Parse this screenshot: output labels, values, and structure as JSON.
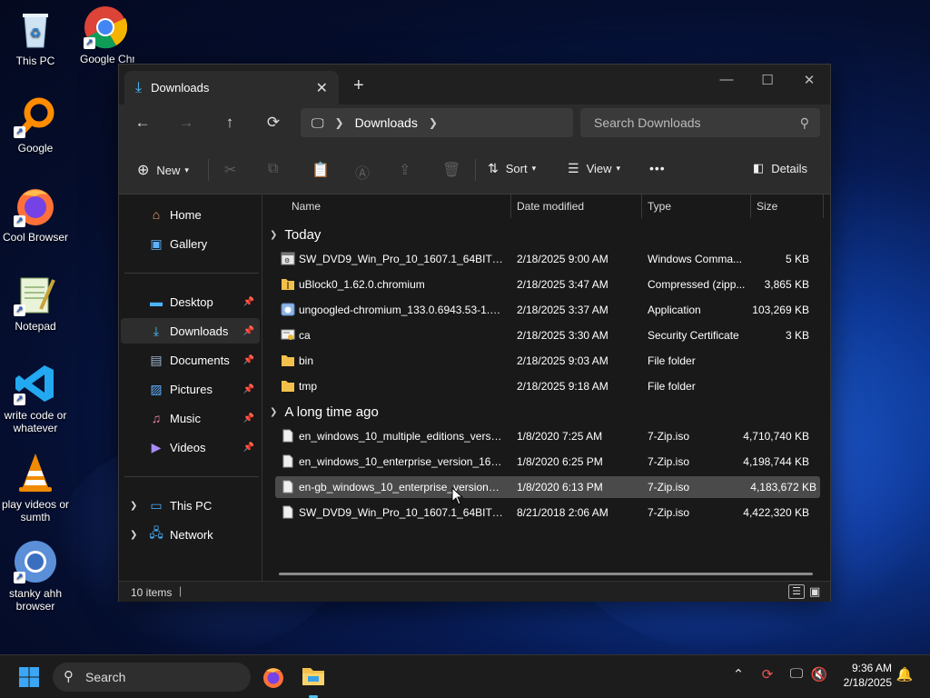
{
  "desktop": {
    "icons": [
      {
        "label": "This PC",
        "icon": "recycle-bin-icon"
      },
      {
        "label": "Google Chrome",
        "icon": "chrome-icon"
      },
      {
        "label": "Google",
        "icon": "magnifier-icon"
      },
      {
        "label": "Cool Browser",
        "icon": "firefox-icon"
      },
      {
        "label": "Notepad",
        "icon": "notepad-icon"
      },
      {
        "label": "write code or whatever",
        "icon": "vscode-icon"
      },
      {
        "label": "play videos or sumth",
        "icon": "vlc-icon"
      },
      {
        "label": "stanky ahh browser",
        "icon": "chromium-icon"
      }
    ]
  },
  "window": {
    "tab_title": "Downloads",
    "breadcrumb": {
      "location": "Downloads"
    },
    "search_placeholder": "Search Downloads",
    "toolbar": {
      "new": "New",
      "sort": "Sort",
      "view": "View",
      "more": "•••",
      "details": "Details"
    },
    "sidebar": {
      "items": [
        {
          "label": "Home"
        },
        {
          "label": "Gallery"
        },
        {
          "label": "Desktop"
        },
        {
          "label": "Downloads"
        },
        {
          "label": "Documents"
        },
        {
          "label": "Pictures"
        },
        {
          "label": "Music"
        },
        {
          "label": "Videos"
        },
        {
          "label": "This PC"
        },
        {
          "label": "Network"
        }
      ]
    },
    "columns": {
      "name": "Name",
      "date": "Date modified",
      "type": "Type",
      "size": "Size"
    },
    "groups": [
      {
        "label": "Today",
        "files": [
          {
            "name": "SW_DVD9_Win_Pro_10_1607.1_64BIT_Eng...",
            "date": "2/18/2025 9:00 AM",
            "type": "Windows Comma...",
            "size": "5 KB"
          },
          {
            "name": "uBlock0_1.62.0.chromium",
            "date": "2/18/2025 3:47 AM",
            "type": "Compressed (zipp...",
            "size": "3,865 KB"
          },
          {
            "name": "ungoogled-chromium_133.0.6943.53-1.1...",
            "date": "2/18/2025 3:37 AM",
            "type": "Application",
            "size": "103,269 KB"
          },
          {
            "name": "ca",
            "date": "2/18/2025 3:30 AM",
            "type": "Security Certificate",
            "size": "3 KB"
          },
          {
            "name": "bin",
            "date": "2/18/2025 9:03 AM",
            "type": "File folder",
            "size": ""
          },
          {
            "name": "tmp",
            "date": "2/18/2025 9:18 AM",
            "type": "File folder",
            "size": ""
          }
        ]
      },
      {
        "label": "A long time ago",
        "files": [
          {
            "name": "en_windows_10_multiple_editions_versio...",
            "date": "1/8/2020 7:25 AM",
            "type": "7-Zip.iso",
            "size": "4,710,740 KB"
          },
          {
            "name": "en_windows_10_enterprise_version_1607_...",
            "date": "1/8/2020 6:25 PM",
            "type": "7-Zip.iso",
            "size": "4,198,744 KB"
          },
          {
            "name": "en-gb_windows_10_enterprise_version_1...",
            "date": "1/8/2020 6:13 PM",
            "type": "7-Zip.iso",
            "size": "4,183,672 KB"
          },
          {
            "name": "SW_DVD9_Win_Pro_10_1607.1_64BIT_Eng...",
            "date": "8/21/2018 2:06 AM",
            "type": "7-Zip.iso",
            "size": "4,422,320 KB"
          }
        ]
      }
    ],
    "status": {
      "count": "10 items"
    }
  },
  "taskbar": {
    "search_label": "Search",
    "time": "9:36 AM",
    "date": "2/18/2025"
  },
  "colors": {
    "accent": "#4cc2ff",
    "folder": "#f3c14b",
    "window_bg": "#191919",
    "selected_row": "#4a4a4a"
  }
}
